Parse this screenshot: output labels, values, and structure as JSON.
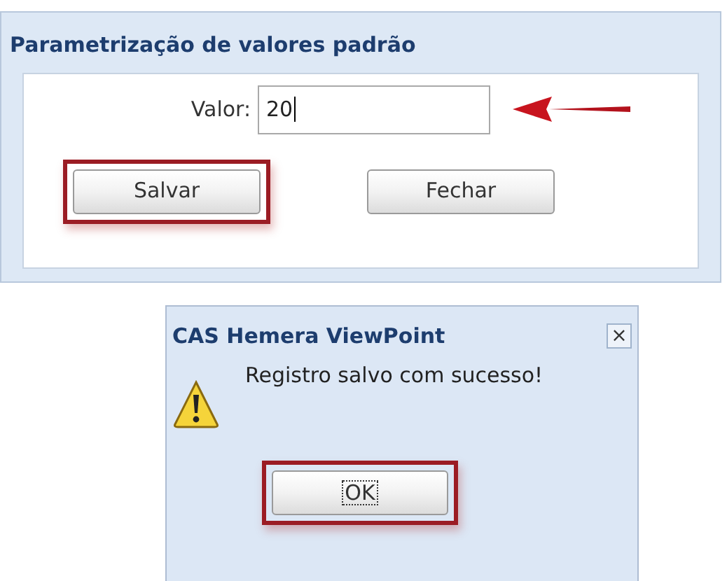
{
  "panel": {
    "title": "Parametrização de valores padrão",
    "field": {
      "label": "Valor:",
      "value": "20"
    },
    "buttons": [
      {
        "label": "Salvar",
        "highlighted": true
      },
      {
        "label": "Fechar",
        "highlighted": false
      }
    ]
  },
  "dialog": {
    "title": "CAS Hemera ViewPoint",
    "close": "×",
    "message": "Registro salvo com sucesso!",
    "button": {
      "label": "OK",
      "highlighted": true,
      "focused": true
    }
  }
}
